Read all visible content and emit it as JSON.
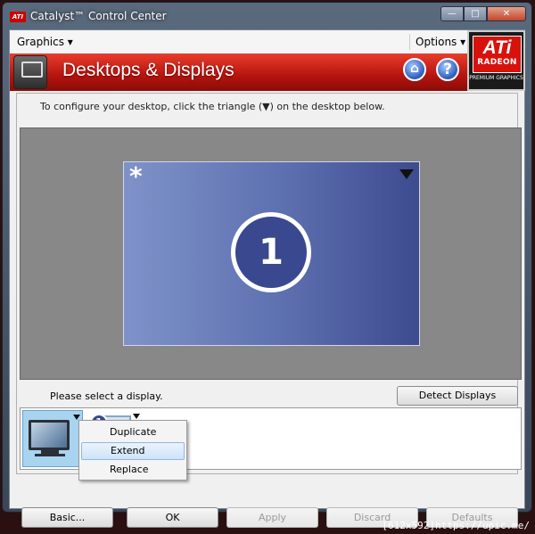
{
  "window": {
    "title": "Catalyst™ Control Center",
    "logo_text": "ATI"
  },
  "menubar": {
    "graphics_label": "Graphics ▾",
    "options_label": "Options ▾"
  },
  "banner": {
    "title": "Desktops & Displays"
  },
  "brand": {
    "ati": "ATi",
    "radeon": "RADEON",
    "premium": "PREMIUM GRAPHICS"
  },
  "main": {
    "instruction": "To configure your desktop, click the triangle (▼) on the desktop below.",
    "desktop_marker": "*",
    "display_number": "1",
    "select_label": "Please select a display.",
    "detect_button": "Detect Displays"
  },
  "context_menu": {
    "items": [
      {
        "label": "Duplicate",
        "highlighted": false
      },
      {
        "label": "Extend",
        "highlighted": true
      },
      {
        "label": "Replace",
        "highlighted": false
      }
    ]
  },
  "buttons": {
    "basic": "Basic...",
    "ok": "OK",
    "apply": "Apply",
    "discard": "Discard",
    "defaults": "Defaults"
  },
  "watermark": "[612x592]https://upic.me/",
  "colors": {
    "accent_red": "#d7120c",
    "desktop_blue": "#5c6faf",
    "display_badge": "#3a4890"
  }
}
